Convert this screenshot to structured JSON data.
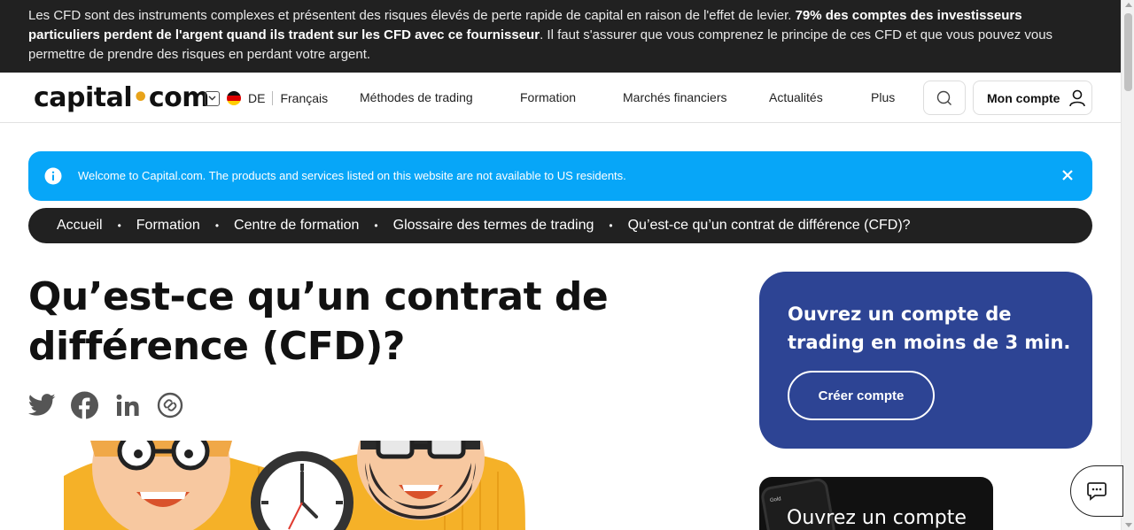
{
  "risk_warning": {
    "text_before": "Les CFD sont des instruments complexes et présentent des risques élevés de perte rapide de capital en raison de l'effet de levier. ",
    "bold": "79% des comptes des investisseurs particuliers perdent de l'argent quand ils tradent sur les CFD avec ce fournisseur",
    "text_after": ". Il faut s'assurer que vous comprenez le principe de ces CFD et que vous pouvez vous permettre de prendre des risques en perdant votre argent."
  },
  "header": {
    "logo_left": "capital",
    "logo_dot": "•",
    "logo_right": "com",
    "country_code": "DE",
    "language": "Français",
    "nav": [
      "Méthodes de trading",
      "Formation",
      "Marchés financiers",
      "Actualités",
      "Plus"
    ],
    "account_label": "Mon compte"
  },
  "notice": {
    "text": "Welcome to Capital.com. The products and services listed on this website are not available to US residents."
  },
  "breadcrumb": [
    "Accueil",
    "Formation",
    "Centre de formation",
    "Glossaire des termes de trading",
    "Qu’est-ce qu’un contrat de différence (CFD)?"
  ],
  "breadcrumb_separator": "•",
  "article": {
    "title_line1": "Qu’est-ce qu’un contrat de",
    "title_line2": "différence (CFD)?",
    "share_icons": [
      "twitter-icon",
      "facebook-icon",
      "linkedin-icon",
      "copy-link-icon"
    ]
  },
  "cta": {
    "heading": "Ouvrez un compte de trading en moins de 3 min.",
    "button": "Créer compte"
  },
  "promo": {
    "text": "Ouvrez un compte",
    "phone_label": "Gold"
  },
  "colors": {
    "risk_bg": "#212121",
    "notice_bg": "#07a6f8",
    "breadcrumb_bg": "#212121",
    "cta_bg": "#2d4494",
    "brand_dot": "#e8a31a"
  }
}
